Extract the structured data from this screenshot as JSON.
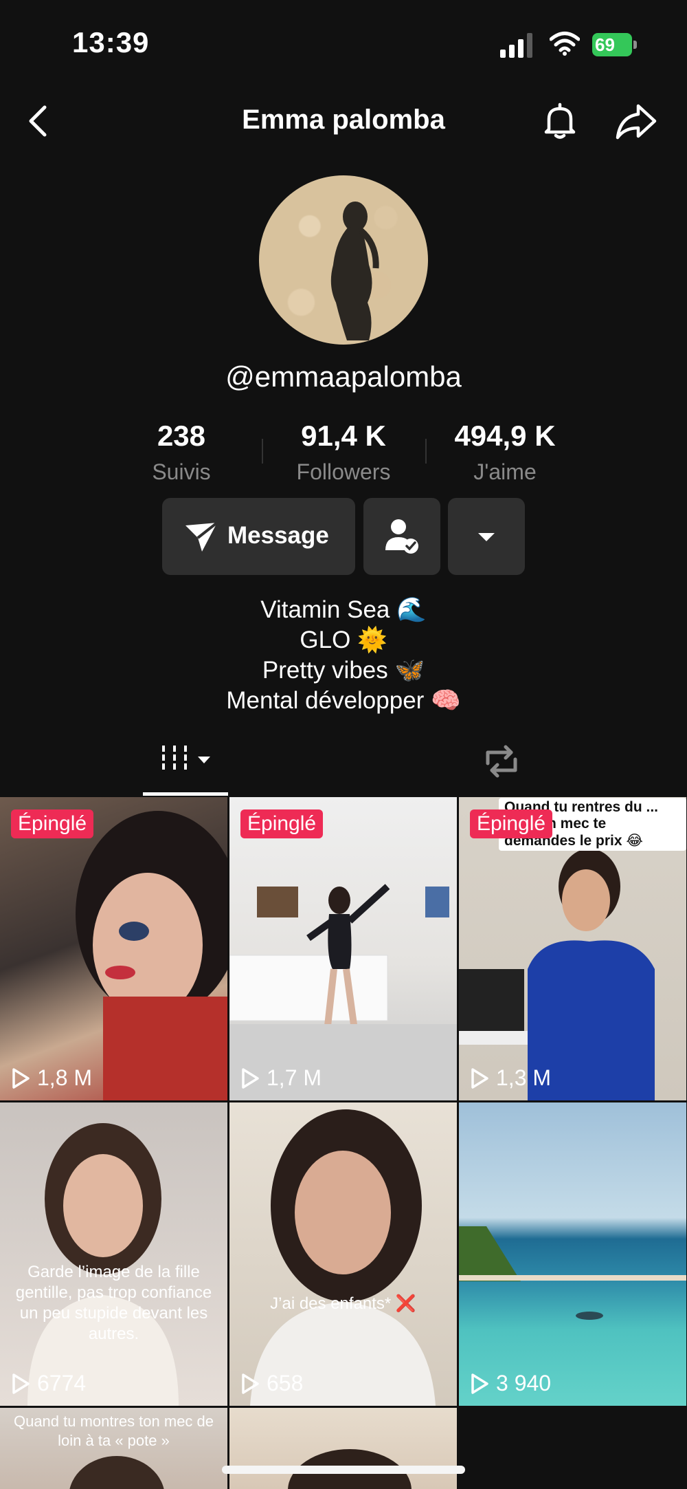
{
  "status_bar": {
    "time": "13:39",
    "battery": "69"
  },
  "nav": {
    "title": "Emma palomba"
  },
  "profile": {
    "handle": "@emmaapalomba",
    "stats": [
      {
        "value": "238",
        "label": "Suivis"
      },
      {
        "value": "91,4 K",
        "label": "Followers"
      },
      {
        "value": "494,9 K",
        "label": "J'aime"
      }
    ],
    "message_label": "Message",
    "bio": [
      "Vitamin Sea 🌊",
      "GLO 🌞",
      "Pretty vibes 🦋",
      "Mental développer 🧠"
    ]
  },
  "videos": [
    {
      "pinned": "Épinglé",
      "views": "1,8 M",
      "caption": ""
    },
    {
      "pinned": "Épinglé",
      "views": "1,7 M",
      "caption": ""
    },
    {
      "pinned": "Épinglé",
      "views": "1,3 M",
      "caption": "Quand tu rentres du ... que ton mec te demandes le prix 😂"
    },
    {
      "pinned": "",
      "views": "6774",
      "caption": "Garde l’image de la fille gentille, pas trop confiance un peu stupide devant les autres."
    },
    {
      "pinned": "",
      "views": "658",
      "caption": "J’ai des enfants* ❌"
    },
    {
      "pinned": "",
      "views": "3 940",
      "caption": ""
    },
    {
      "pinned": "",
      "views": "",
      "caption": "Quand tu montres ton mec de loin à ta « pote »"
    }
  ]
}
